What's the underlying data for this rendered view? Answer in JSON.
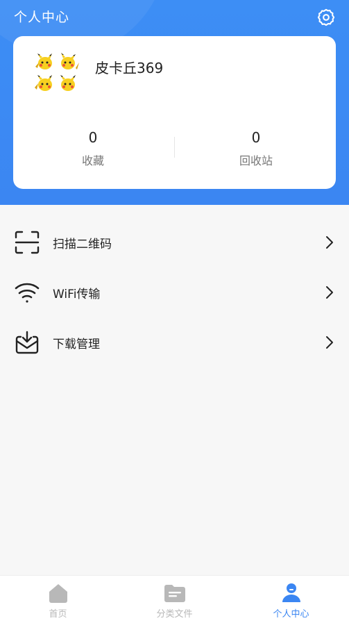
{
  "header": {
    "title": "个人中心",
    "settings_icon": "gear-icon"
  },
  "profile": {
    "username": "皮卡丘369",
    "avatar_icon": "pikachu-avatar",
    "stats": [
      {
        "value": "0",
        "label": "收藏"
      },
      {
        "value": "0",
        "label": "回收站"
      }
    ]
  },
  "menu": [
    {
      "label": "扫描二维码",
      "icon": "scan-icon"
    },
    {
      "label": "WiFi传输",
      "icon": "wifi-icon"
    },
    {
      "label": "下载管理",
      "icon": "download-box-icon"
    }
  ],
  "tabbar": {
    "tabs": [
      {
        "label": "首页",
        "icon": "home-icon",
        "active": false
      },
      {
        "label": "分类文件",
        "icon": "folder-icon",
        "active": false
      },
      {
        "label": "个人中心",
        "icon": "user-icon",
        "active": true
      }
    ]
  },
  "colors": {
    "accent": "#3b86f2",
    "pikachu": "#f7d020"
  }
}
